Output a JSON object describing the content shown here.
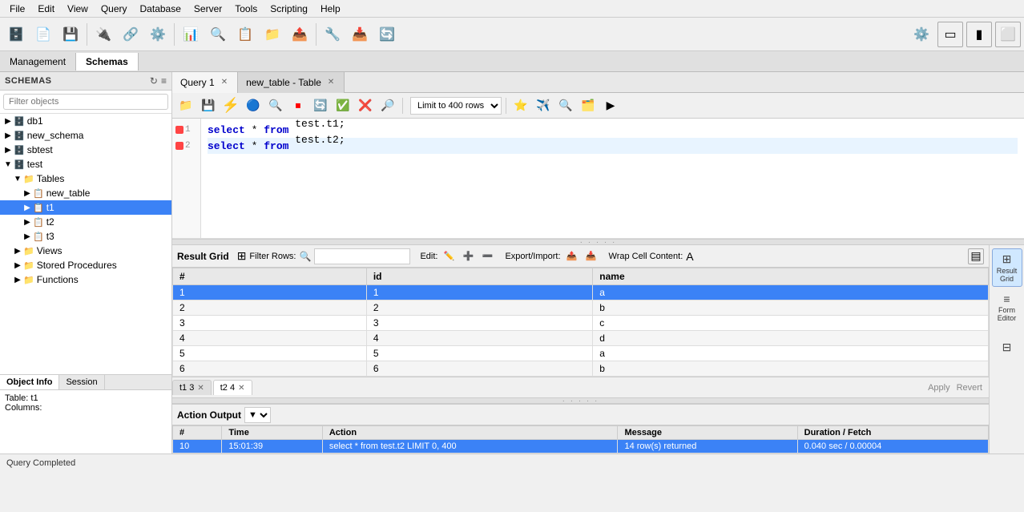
{
  "menubar": {
    "items": [
      "File",
      "Edit",
      "View",
      "Query",
      "Database",
      "Server",
      "Tools",
      "Scripting",
      "Help"
    ]
  },
  "schema_tabs": {
    "tabs": [
      "Management",
      "Schemas"
    ],
    "active": "Schemas"
  },
  "sidebar": {
    "title": "SCHEMAS",
    "filter_placeholder": "Filter objects",
    "tree": [
      {
        "id": "db1",
        "label": "db1",
        "indent": 0,
        "type": "schema",
        "expanded": false
      },
      {
        "id": "new_schema",
        "label": "new_schema",
        "indent": 0,
        "type": "schema",
        "expanded": false
      },
      {
        "id": "sbtest",
        "label": "sbtest",
        "indent": 0,
        "type": "schema",
        "expanded": false
      },
      {
        "id": "test",
        "label": "test",
        "indent": 0,
        "type": "schema",
        "expanded": true
      },
      {
        "id": "tables",
        "label": "Tables",
        "indent": 1,
        "type": "folder",
        "expanded": true
      },
      {
        "id": "new_table",
        "label": "new_table",
        "indent": 2,
        "type": "table",
        "expanded": false
      },
      {
        "id": "t1",
        "label": "t1",
        "indent": 2,
        "type": "table",
        "expanded": false,
        "selected": true
      },
      {
        "id": "t2",
        "label": "t2",
        "indent": 2,
        "type": "table",
        "expanded": false
      },
      {
        "id": "t3",
        "label": "t3",
        "indent": 2,
        "type": "table",
        "expanded": false
      },
      {
        "id": "views",
        "label": "Views",
        "indent": 1,
        "type": "folder",
        "expanded": false
      },
      {
        "id": "stored_procs",
        "label": "Stored Procedures",
        "indent": 1,
        "type": "folder",
        "expanded": false
      },
      {
        "id": "functions",
        "label": "Functions",
        "indent": 1,
        "type": "folder",
        "expanded": false
      }
    ]
  },
  "query_tabs": {
    "tabs": [
      {
        "label": "Query 1",
        "active": true
      },
      {
        "label": "new_table - Table",
        "active": false
      }
    ]
  },
  "editor": {
    "lines": [
      {
        "num": 1,
        "error": true,
        "code": "select * from test.t1;"
      },
      {
        "num": 2,
        "error": true,
        "code": "select * from test.t2;",
        "cursor": true
      }
    ]
  },
  "result_toolbar": {
    "label": "Result Grid",
    "filter_rows_label": "Filter Rows:",
    "filter_placeholder": "",
    "edit_label": "Edit:",
    "export_label": "Export/Import:",
    "wrap_label": "Wrap Cell Content:"
  },
  "result_grid": {
    "columns": [
      "#",
      "id",
      "name"
    ],
    "rows": [
      {
        "row_num": 1,
        "id": "1",
        "name": "a",
        "selected": true
      },
      {
        "row_num": 2,
        "id": "2",
        "name": "b",
        "selected": false
      },
      {
        "row_num": 3,
        "id": "3",
        "name": "c",
        "selected": false
      },
      {
        "row_num": 4,
        "id": "4",
        "name": "d",
        "selected": false
      },
      {
        "row_num": 5,
        "id": "5",
        "name": "a",
        "selected": false
      },
      {
        "row_num": 6,
        "id": "6",
        "name": "b",
        "selected": false
      }
    ]
  },
  "result_tabs": [
    {
      "label": "t1",
      "count": "3",
      "active": false
    },
    {
      "label": "t2",
      "count": "4",
      "active": true
    }
  ],
  "side_buttons": [
    {
      "label": "Result\nGrid",
      "active": true,
      "icon": "⊞"
    },
    {
      "label": "Form\nEditor",
      "active": false,
      "icon": "≡"
    },
    {
      "label": "",
      "active": false,
      "icon": "⊟"
    }
  ],
  "action_output": {
    "title": "Action Output",
    "columns": [
      "#",
      "Time",
      "Action",
      "Message",
      "Duration / Fetch"
    ],
    "rows": [
      {
        "num": "10",
        "time": "15:01:39",
        "action": "select * from test.t2 LIMIT 0, 400",
        "message": "14 row(s) returned",
        "duration": "0.040 sec / 0.00004",
        "selected": true
      }
    ]
  },
  "bottom_panel": {
    "tabs": [
      "Object Info",
      "Session"
    ],
    "active": "Object Info",
    "object_info": {
      "table": "Table: t1",
      "columns": "Columns:"
    }
  },
  "status_bar": {
    "text": "Query Completed"
  },
  "apply_revert": {
    "apply": "Apply",
    "revert": "Revert"
  },
  "limit_options": [
    "Limit to 400 rows"
  ],
  "limit_value": "Limit to 400 rows"
}
